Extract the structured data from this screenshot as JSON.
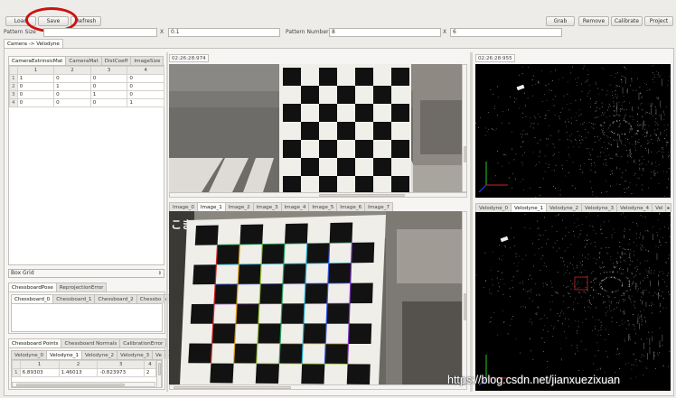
{
  "toolbar": {
    "load": "Load",
    "save": "Save",
    "refresh": "Refresh",
    "grab": "Grab",
    "remove": "Remove",
    "calibrate": "Calibrate",
    "project": "Project"
  },
  "pattern": {
    "size_label": "Pattern Size",
    "size_x_label": "X",
    "size_x_value": "0.1",
    "number_label": "Pattern Number",
    "number_value": "8",
    "number_x_label": "X",
    "number_x_value": "6"
  },
  "top_tab": "Camera -> Velodyne",
  "matrix_tabs": [
    "CameraExtrinsicMat",
    "CameraMat",
    "DistCoeff",
    "ImageSize"
  ],
  "matrix": {
    "headers": [
      "1",
      "2",
      "3",
      "4"
    ],
    "rows": [
      {
        "h": "1",
        "c": [
          "1",
          "0",
          "0",
          "0"
        ]
      },
      {
        "h": "2",
        "c": [
          "0",
          "1",
          "0",
          "0"
        ]
      },
      {
        "h": "3",
        "c": [
          "0",
          "0",
          "1",
          "0"
        ]
      },
      {
        "h": "4",
        "c": [
          "0",
          "0",
          "0",
          "1"
        ]
      }
    ]
  },
  "box_grid": "Box Grid",
  "chessboard_tabs": [
    "ChessboardPose",
    "ReprojectionError"
  ],
  "chessboard_subtabs": [
    "Chessboard_0",
    "Chessboard_1",
    "Chessboard_2",
    "Chessbo"
  ],
  "points_tabs": [
    "Chessboard Points",
    "Chessboard Normals",
    "CalibrationError"
  ],
  "velodyne_points_tabs": [
    "Velodyne_0",
    "Velodyne_1",
    "Velodyne_2",
    "Velodyne_3",
    "Ve"
  ],
  "points_table": {
    "headers": [
      "1",
      "2",
      "3",
      "4"
    ],
    "rows": [
      {
        "h": "1",
        "c": [
          "6.89303",
          "1.46013",
          "-0.823973",
          "2"
        ]
      }
    ]
  },
  "camera_timestamp": "02:26:28:974",
  "velodyne_timestamp": "02:26:28:955",
  "image_tabs": [
    "Image_0",
    "Image_1",
    "Image_2",
    "Image_3",
    "Image_4",
    "Image_5",
    "Image_6",
    "Image_7"
  ],
  "velodyne_tabs": [
    "Velodyne_0",
    "Velodyne_1",
    "Velodyne_2",
    "Velodyne_3",
    "Velodyne_4",
    "Vel"
  ],
  "image_sign": "こま",
  "watermark": "https://blog.csdn.net/jianxuezixuan",
  "colors": {
    "annotation_circle": "#cc1111",
    "chess_line_colors": [
      "#d01c1c",
      "#e0a010",
      "#9acd32",
      "#22a05a",
      "#20b0d0",
      "#3050e0",
      "#8030c0"
    ]
  }
}
